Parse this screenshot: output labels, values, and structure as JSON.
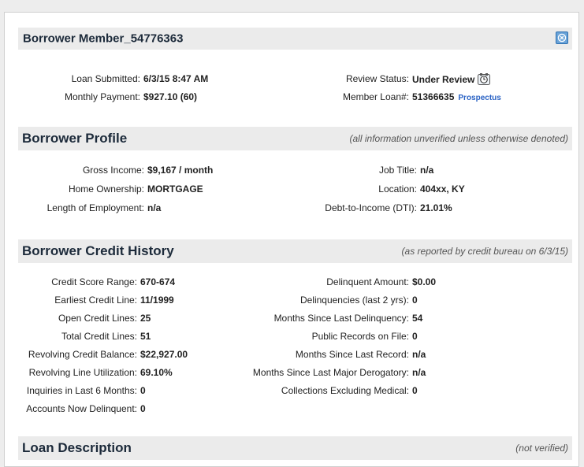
{
  "header": {
    "title": "Borrower Member_54776363",
    "close_icon": "close-icon"
  },
  "summary": {
    "loan_submitted_label": "Loan Submitted:",
    "loan_submitted_value": "6/3/15 8:47 AM",
    "monthly_payment_label": "Monthly Payment:",
    "monthly_payment_value": "$927.10 (60)",
    "review_status_label": "Review Status:",
    "review_status_value": "Under Review",
    "member_loan_label": "Member Loan#:",
    "member_loan_value": "51366635",
    "prospectus_link": "Prospectus"
  },
  "profile": {
    "title": "Borrower Profile",
    "note": "(all information unverified unless otherwise denoted)",
    "left": [
      {
        "label": "Gross Income:",
        "value": "$9,167 / month"
      },
      {
        "label": "Home Ownership:",
        "value": "MORTGAGE"
      },
      {
        "label": "Length of Employment:",
        "value": "n/a"
      }
    ],
    "right": [
      {
        "label": "Job Title:",
        "value": "n/a"
      },
      {
        "label": "Location:",
        "value": "404xx, KY"
      },
      {
        "label": "Debt-to-Income (DTI):",
        "value": "21.01%"
      }
    ]
  },
  "credit": {
    "title": "Borrower Credit History",
    "note": "(as reported by credit bureau on 6/3/15)",
    "left": [
      {
        "label": "Credit Score Range:",
        "value": "670-674"
      },
      {
        "label": "Earliest Credit Line:",
        "value": "11/1999"
      },
      {
        "label": "Open Credit Lines:",
        "value": "25"
      },
      {
        "label": "Total Credit Lines:",
        "value": "51"
      },
      {
        "label": "Revolving Credit Balance:",
        "value": "$22,927.00"
      },
      {
        "label": "Revolving Line Utilization:",
        "value": "69.10%"
      },
      {
        "label": "Inquiries in Last 6 Months:",
        "value": "0"
      },
      {
        "label": "Accounts Now Delinquent:",
        "value": "0"
      }
    ],
    "right": [
      {
        "label": "Delinquent Amount:",
        "value": "$0.00"
      },
      {
        "label": "Delinquencies (last 2 yrs):",
        "value": "0"
      },
      {
        "label": "Months Since Last Delinquency:",
        "value": "54"
      },
      {
        "label": "Public Records on File:",
        "value": "0"
      },
      {
        "label": "Months Since Last Record:",
        "value": "n/a"
      },
      {
        "label": "Months Since Last Major Derogatory:",
        "value": "n/a"
      },
      {
        "label": "Collections Excluding Medical:",
        "value": "0"
      }
    ]
  },
  "description": {
    "title": "Loan Description",
    "note": "(not verified)"
  }
}
